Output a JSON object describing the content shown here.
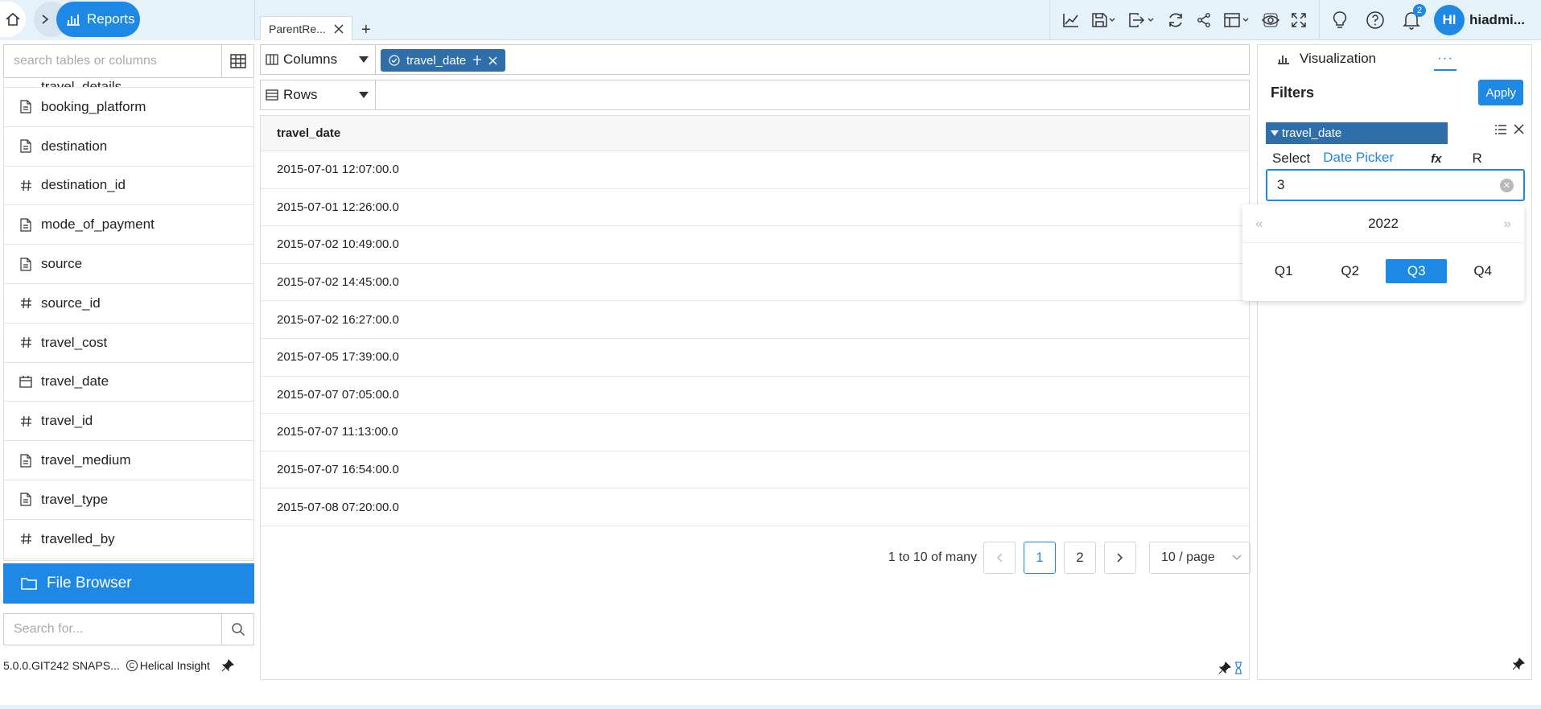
{
  "topbar": {
    "breadcrumb_reports": "Reports",
    "tab_label": "ParentRe...",
    "tab_add": "+",
    "notifications_count": "2",
    "user_initials": "HI",
    "user_name": "hiadmi..."
  },
  "left": {
    "search_placeholder": "search tables or columns",
    "cut_item": "travel_details",
    "fields": [
      {
        "name": "booking_platform",
        "icon": "text-icon"
      },
      {
        "name": "destination",
        "icon": "text-icon"
      },
      {
        "name": "destination_id",
        "icon": "hash-icon"
      },
      {
        "name": "mode_of_payment",
        "icon": "text-icon"
      },
      {
        "name": "source",
        "icon": "text-icon"
      },
      {
        "name": "source_id",
        "icon": "hash-icon"
      },
      {
        "name": "travel_cost",
        "icon": "hash-icon"
      },
      {
        "name": "travel_date",
        "icon": "calendar-icon"
      },
      {
        "name": "travel_id",
        "icon": "hash-icon"
      },
      {
        "name": "travel_medium",
        "icon": "text-icon"
      },
      {
        "name": "travel_type",
        "icon": "text-icon"
      },
      {
        "name": "travelled_by",
        "icon": "hash-icon"
      }
    ],
    "file_browser": "File Browser",
    "search2_placeholder": "Search for...",
    "version": "5.0.0.GIT242 SNAPS...",
    "copyright": "Helical Insight"
  },
  "center": {
    "columns_label": "Columns",
    "rows_label": "Rows",
    "column_chip": "travel_date",
    "table_header": "travel_date",
    "rows": [
      "2015-07-01 12:07:00.0",
      "2015-07-01 12:26:00.0",
      "2015-07-02 10:49:00.0",
      "2015-07-02 14:45:00.0",
      "2015-07-02 16:27:00.0",
      "2015-07-05 17:39:00.0",
      "2015-07-07 07:05:00.0",
      "2015-07-07 11:13:00.0",
      "2015-07-07 16:54:00.0",
      "2015-07-08 07:20:00.0"
    ],
    "pager": {
      "summary": "1 to 10 of many",
      "page1": "1",
      "page2": "2",
      "page_size": "10 / page"
    }
  },
  "right": {
    "tab_visualization": "Visualization",
    "tab_more": "···",
    "filters_title": "Filters",
    "apply_label": "Apply",
    "filter_field": "travel_date",
    "modes": [
      "Select",
      "Date Picker",
      "fx",
      "R"
    ],
    "active_mode": "Date Picker",
    "date_value": "3"
  },
  "quarter_picker": {
    "year": "2022",
    "prev": "«",
    "next": "»",
    "quarters": [
      "Q1",
      "Q2",
      "Q3",
      "Q4"
    ],
    "selected": "Q3"
  },
  "colors": {
    "accent": "#1e88e5",
    "chip": "#2f6ea8",
    "topbar_bg": "#e6f2fa"
  }
}
